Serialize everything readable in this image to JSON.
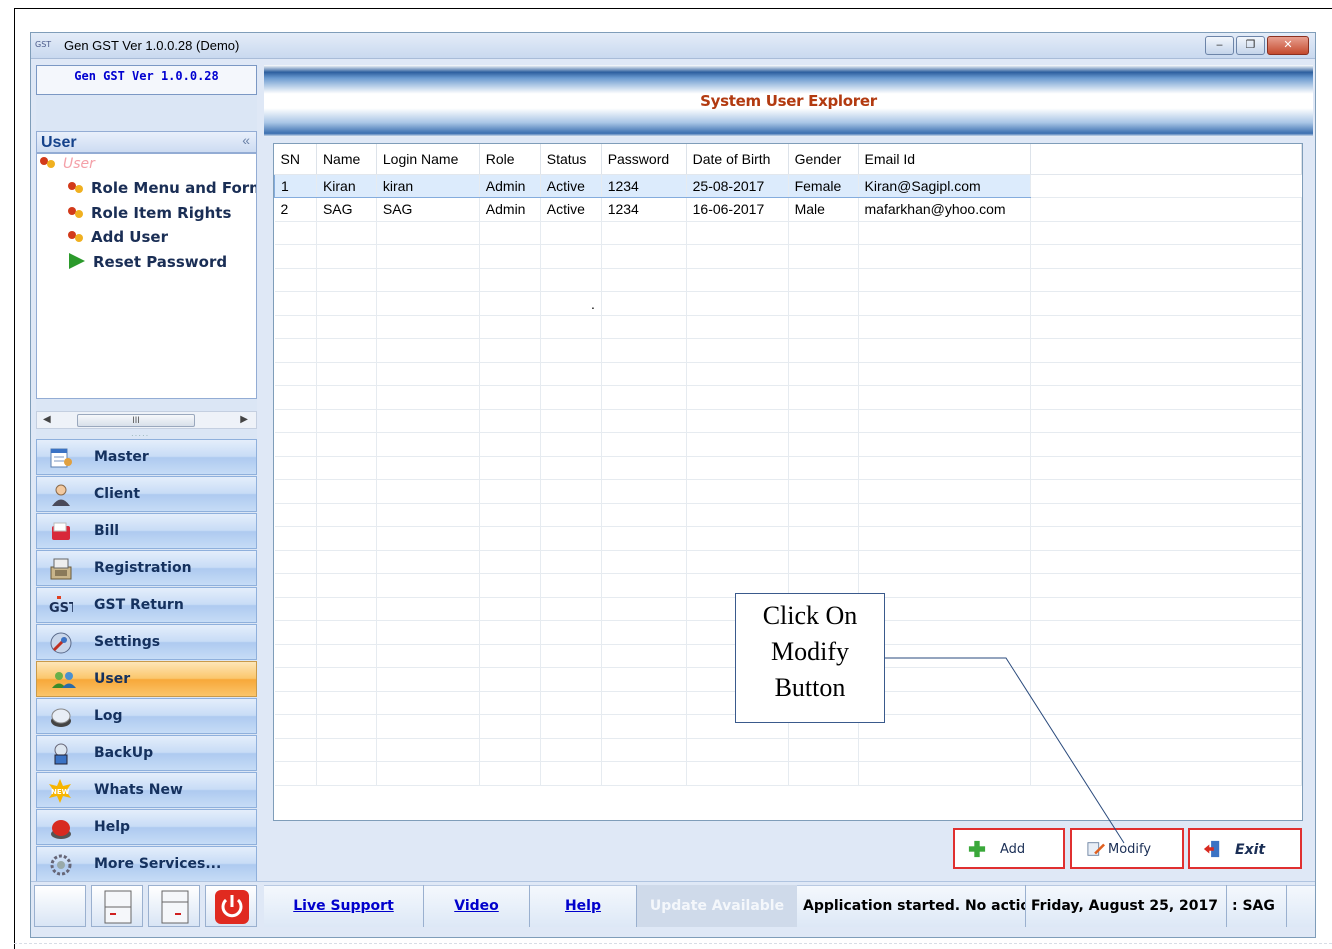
{
  "window": {
    "app_badge": "GST",
    "title": "Gen GST  Ver 1.0.0.28 (Demo)",
    "minimize_icon": "minimize-icon",
    "restore_icon": "restore-icon",
    "close_icon": "close-icon",
    "minimize_glyph": "‒",
    "restore_glyph": "❐",
    "close_glyph": "✕"
  },
  "sidebar": {
    "version": "Gen GST  Ver 1.0.0.28",
    "tree_title": "User",
    "collapse_glyph": "«",
    "tree_root": "User",
    "tree_items": [
      {
        "label": "Role Menu and Form",
        "icon": "role-icon"
      },
      {
        "label": "Role Item Rights",
        "icon": "role-icon"
      },
      {
        "label": "Add User",
        "icon": "role-icon"
      },
      {
        "label": "Reset Password",
        "icon": "play-icon"
      }
    ],
    "scroll_thumb": "III",
    "nav_items": [
      {
        "label": "Master",
        "icon": "master-icon"
      },
      {
        "label": "Client",
        "icon": "client-icon"
      },
      {
        "label": "Bill",
        "icon": "bill-icon"
      },
      {
        "label": "Registration",
        "icon": "registration-icon"
      },
      {
        "label": "GST Return",
        "icon": "gst-icon"
      },
      {
        "label": "Settings",
        "icon": "settings-icon"
      },
      {
        "label": "User",
        "icon": "user-icon",
        "active": true
      },
      {
        "label": "Log",
        "icon": "log-icon"
      },
      {
        "label": "BackUp",
        "icon": "backup-icon"
      },
      {
        "label": "Whats New",
        "icon": "new-icon"
      },
      {
        "label": "Help",
        "icon": "help-icon"
      },
      {
        "label": "More Services...",
        "icon": "services-icon"
      }
    ],
    "gst_logo_text": "GST",
    "new_badge_text": "NEW"
  },
  "main": {
    "banner_title": "System User Explorer",
    "grid": {
      "columns": [
        "SN",
        "Name",
        "Login Name",
        "Role",
        "Status",
        "Password",
        "Date of Birth",
        "Gender",
        "Email Id"
      ],
      "rows": [
        [
          "1",
          "Kiran",
          "kiran",
          "Admin",
          "Active",
          "1234",
          "25-08-2017",
          "Female",
          "Kiran@Sagipl.com"
        ],
        [
          "2",
          "SAG",
          "SAG",
          "Admin",
          "Active",
          "1234",
          "16-06-2017",
          "Male",
          "mafarkhan@yhoo.com"
        ]
      ],
      "selected_row": 0,
      "stray_mark": "."
    },
    "callout": {
      "line1": "Click On",
      "line2": "Modify",
      "line3": "Button"
    },
    "buttons": {
      "add": "Add",
      "modify": "Modify",
      "exit": "Exit"
    }
  },
  "statusbar": {
    "links": [
      "Live Support",
      "Video",
      "Help"
    ],
    "update": "Update Available",
    "message": "Application started. No action",
    "date": "Friday, August 25, 2017",
    "user": ": SAG"
  },
  "colors": {
    "accent": "#15428b",
    "banner_title": "#b23a10",
    "active_nav": "#f7a83a",
    "button_border": "#e03030",
    "link": "#0000cc"
  }
}
